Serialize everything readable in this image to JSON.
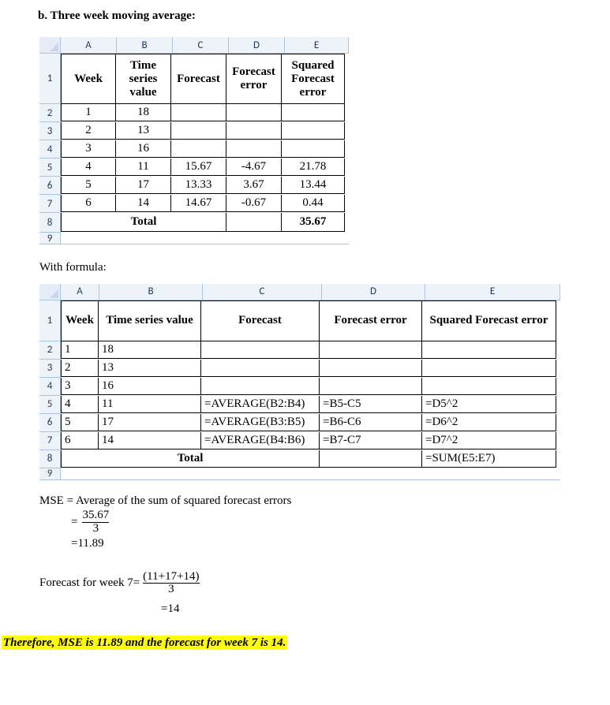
{
  "heading": "b.   Three week moving average:",
  "column_letters": [
    "A",
    "B",
    "C",
    "D",
    "E"
  ],
  "headers": {
    "week": "Week",
    "ts": "Time\nseries\nvalue",
    "ts_flat": "Time series value",
    "fc": "Forecast",
    "fce": "Forecast\nerror",
    "fce_flat": "Forecast error",
    "sfe": "Squared\nForecast\nerror",
    "sfe_flat": "Squared Forecast error"
  },
  "row_numbers_t1": [
    "1",
    "2",
    "3",
    "4",
    "5",
    "6",
    "7",
    "8",
    "9"
  ],
  "table1": [
    {
      "w": "1",
      "ts": "18",
      "fc": "",
      "fce": "",
      "sfe": ""
    },
    {
      "w": "2",
      "ts": "13",
      "fc": "",
      "fce": "",
      "sfe": ""
    },
    {
      "w": "3",
      "ts": "16",
      "fc": "",
      "fce": "",
      "sfe": ""
    },
    {
      "w": "4",
      "ts": "11",
      "fc": "15.67",
      "fce": "-4.67",
      "sfe": "21.78"
    },
    {
      "w": "5",
      "ts": "17",
      "fc": "13.33",
      "fce": "3.67",
      "sfe": "13.44"
    },
    {
      "w": "6",
      "ts": "14",
      "fc": "14.67",
      "fce": "-0.67",
      "sfe": "0.44"
    }
  ],
  "total_label": "Total",
  "total_value": "35.67",
  "with_formula": "With formula:",
  "row_numbers_t2": [
    "1",
    "2",
    "3",
    "4",
    "5",
    "6",
    "7",
    "8",
    "9"
  ],
  "table2": [
    {
      "w": "1",
      "ts": "18",
      "fc": "",
      "fce": "",
      "sfe": ""
    },
    {
      "w": "2",
      "ts": "13",
      "fc": "",
      "fce": "",
      "sfe": ""
    },
    {
      "w": "3",
      "ts": "16",
      "fc": "",
      "fce": "",
      "sfe": ""
    },
    {
      "w": "4",
      "ts": "11",
      "fc": "=AVERAGE(B2:B4)",
      "fce": "=B5-C5",
      "sfe": "=D5^2"
    },
    {
      "w": "5",
      "ts": "17",
      "fc": "=AVERAGE(B3:B5)",
      "fce": "=B6-C6",
      "sfe": "=D6^2"
    },
    {
      "w": "6",
      "ts": "14",
      "fc": "=AVERAGE(B4:B6)",
      "fce": "=B7-C7",
      "sfe": "=D7^2"
    }
  ],
  "total2_sfe": "=SUM(E5:E7)",
  "mse_label": "MSE = Average of the sum of squared forecast errors",
  "mse_eq": {
    "eq": "=",
    "num": "35.67",
    "den": "3"
  },
  "mse_result": "=11.89",
  "fc7_label": "Forecast for week 7=",
  "fc7_frac": {
    "num": "(11+17+14)",
    "den": "3"
  },
  "fc7_result": "=14",
  "conclusion": "Therefore, MSE is 11.89 and the forecast for week 7 is 14.",
  "chart_data": {
    "type": "table",
    "title": "Three week moving average",
    "columns": [
      "Week",
      "Time series value",
      "Forecast",
      "Forecast error",
      "Squared Forecast error"
    ],
    "rows": [
      [
        1,
        18,
        null,
        null,
        null
      ],
      [
        2,
        13,
        null,
        null,
        null
      ],
      [
        3,
        16,
        null,
        null,
        null
      ],
      [
        4,
        11,
        15.67,
        -4.67,
        21.78
      ],
      [
        5,
        17,
        13.33,
        3.67,
        13.44
      ],
      [
        6,
        14,
        14.67,
        -0.67,
        0.44
      ]
    ],
    "total_squared_error": 35.67,
    "mse": 11.89,
    "forecast_week_7": 14
  }
}
